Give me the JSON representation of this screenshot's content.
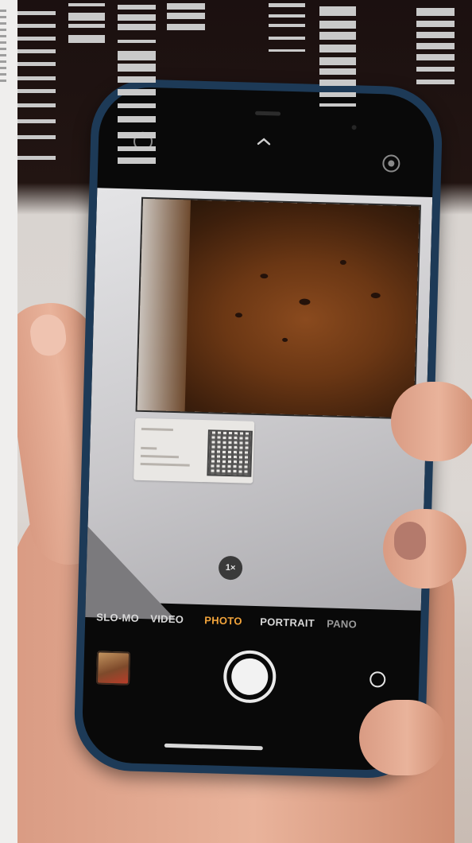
{
  "camera": {
    "modes": [
      "SLO-MO",
      "VIDEO",
      "PHOTO",
      "PORTRAIT",
      "PANO"
    ],
    "active_mode": "PHOTO",
    "zoom_label": "1×",
    "active_color": "#f2a43b"
  },
  "label_card": {
    "title": "Report 2",
    "lines": [
      "Case",
      "Company ...",
      "Date ..."
    ]
  },
  "icons": [
    "flash-icon",
    "chevron-up-icon",
    "live-photo-icon",
    "flip-camera-icon",
    "qr-code-icon"
  ]
}
